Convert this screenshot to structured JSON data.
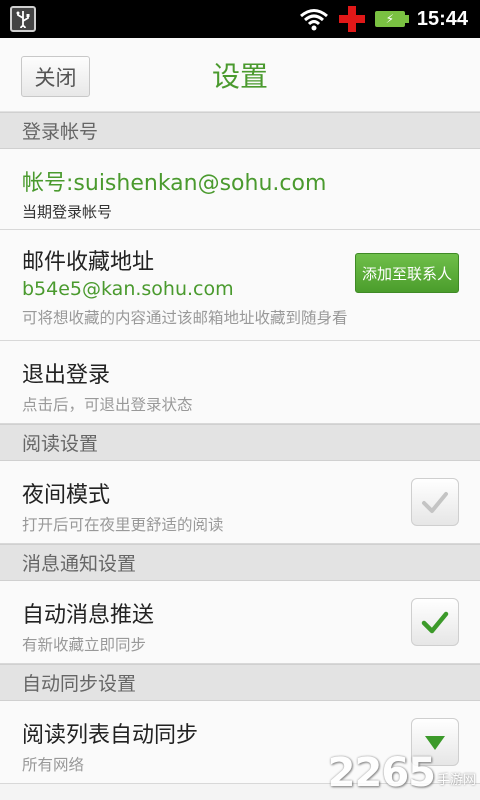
{
  "status_bar": {
    "time": "15:44",
    "icons": [
      "usb-icon",
      "wifi-icon",
      "red-cross-icon",
      "battery-charging-icon"
    ]
  },
  "header": {
    "close_label": "关闭",
    "title": "设置"
  },
  "sections": {
    "account": {
      "header": "登录帐号",
      "account_text": "帐号:suishenkan@sohu.com",
      "account_sub": "当期登录帐号",
      "mail_title": "邮件收藏地址",
      "mail_address": "b54e5@kan.sohu.com",
      "mail_sub": "可将想收藏的内容通过该邮箱地址收藏到随身看",
      "add_contact_label": "添加至联系人",
      "logout_title": "退出登录",
      "logout_sub": "点击后，可退出登录状态"
    },
    "reading": {
      "header": "阅读设置",
      "night_title": "夜间模式",
      "night_sub": "打开后可在夜里更舒适的阅读",
      "night_checked": false
    },
    "notify": {
      "header": "消息通知设置",
      "push_title": "自动消息推送",
      "push_sub": "有新收藏立即同步",
      "push_checked": true
    },
    "sync": {
      "header": "自动同步设置",
      "sync_title": "阅读列表自动同步",
      "sync_sub": "所有网络"
    }
  },
  "watermark": {
    "digits": "2265",
    "text": "手游网"
  },
  "colors": {
    "accent_green": "#4a9a2e",
    "status_bar": "#000000",
    "section_bg": "#e3e3e3"
  }
}
